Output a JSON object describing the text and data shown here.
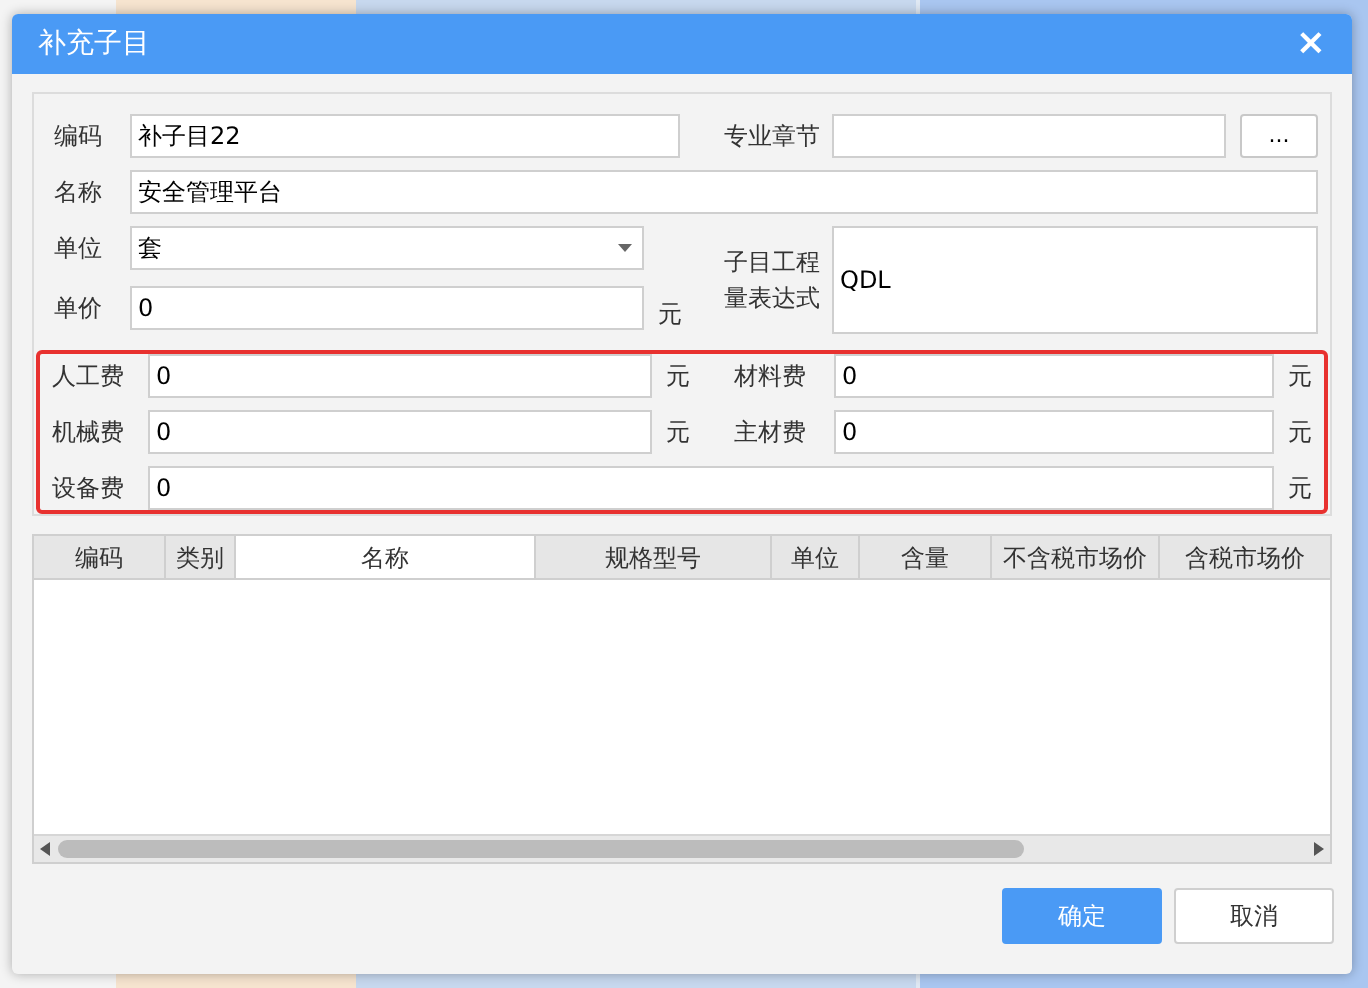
{
  "window": {
    "title": "补充子目",
    "close": "×"
  },
  "form": {
    "code": {
      "label": "编码",
      "value": "补子目22"
    },
    "chapter": {
      "label": "专业章节",
      "button": "..."
    },
    "name": {
      "label": "名称",
      "value": "安全管理平台"
    },
    "unit": {
      "label": "单位",
      "value": "套"
    },
    "expression": {
      "label": "子目工程量表达式",
      "value": "QDL"
    },
    "price": {
      "label": "单价",
      "value": "0",
      "suffix": "元"
    }
  },
  "costs": [
    {
      "label": "人工费",
      "value": "0",
      "suffix": "元"
    },
    {
      "label": "材料费",
      "value": "0",
      "suffix": "元"
    },
    {
      "label": "机械费",
      "value": "0",
      "suffix": "元"
    },
    {
      "label": "主材费",
      "value": "0",
      "suffix": "元"
    },
    {
      "label": "设备费",
      "value": "0",
      "suffix": "元"
    }
  ],
  "table": {
    "columns": [
      {
        "label": "编码",
        "selected": false
      },
      {
        "label": "类别",
        "selected": false
      },
      {
        "label": "名称",
        "selected": true
      },
      {
        "label": "规格型号",
        "selected": false
      },
      {
        "label": "单位",
        "selected": false
      },
      {
        "label": "含量",
        "selected": false
      },
      {
        "label": "不含税市场价",
        "selected": false
      },
      {
        "label": "含税市场价",
        "selected": false
      }
    ]
  },
  "buttons": [
    {
      "label": "确定",
      "kind": "primary"
    },
    {
      "label": "取消",
      "kind": "secondary"
    }
  ]
}
